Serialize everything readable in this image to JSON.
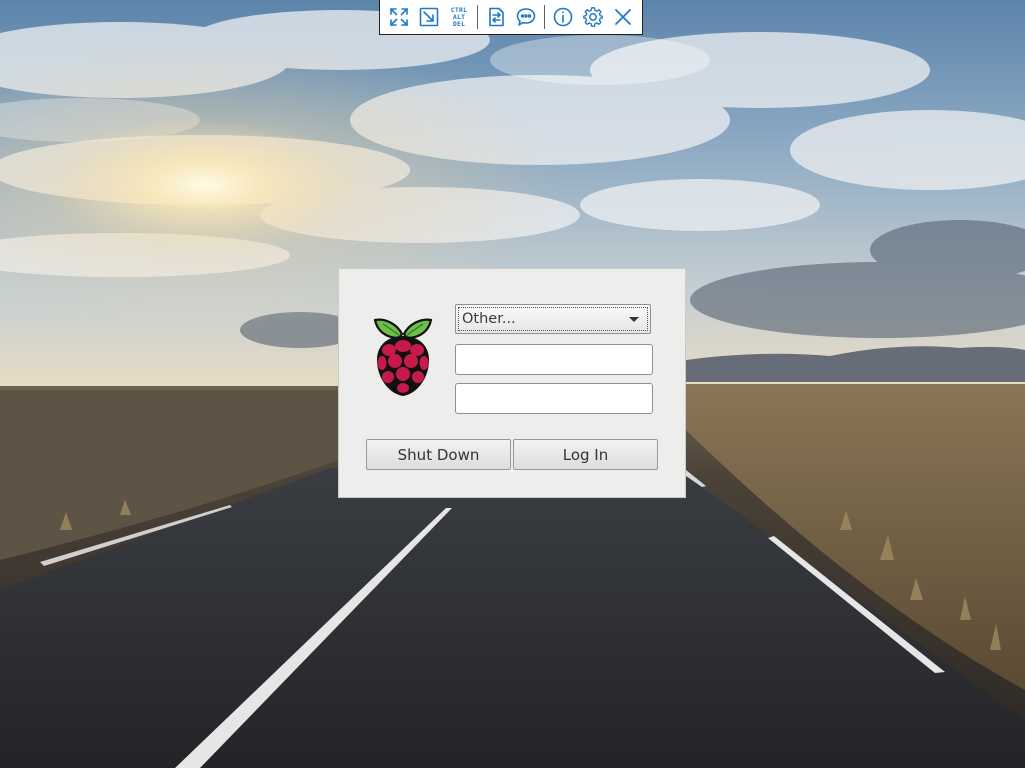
{
  "colors": {
    "toolbar_icon": "#1f78c8",
    "dialog_bg": "#ededeb",
    "raspberry_red": "#c51a4a",
    "leaf_green": "#6cc04a"
  },
  "toolbar": {
    "items": [
      {
        "icon": "fullscreen-icon"
      },
      {
        "icon": "scale-to-fit-icon"
      },
      {
        "icon": "ctrl-alt-del-icon",
        "lines": [
          "CTRL",
          "ALT",
          "DEL"
        ]
      },
      {
        "icon": "file-transfer-icon"
      },
      {
        "icon": "chat-icon"
      },
      {
        "icon": "info-icon"
      },
      {
        "icon": "gear-icon"
      },
      {
        "icon": "close-icon"
      }
    ]
  },
  "login": {
    "logo_icon": "raspberry-pi-logo",
    "user_select": {
      "selected": "Other..."
    },
    "username": {
      "value": "",
      "placeholder": ""
    },
    "password": {
      "value": "",
      "placeholder": ""
    },
    "shutdown_label": "Shut Down",
    "login_label": "Log In"
  }
}
